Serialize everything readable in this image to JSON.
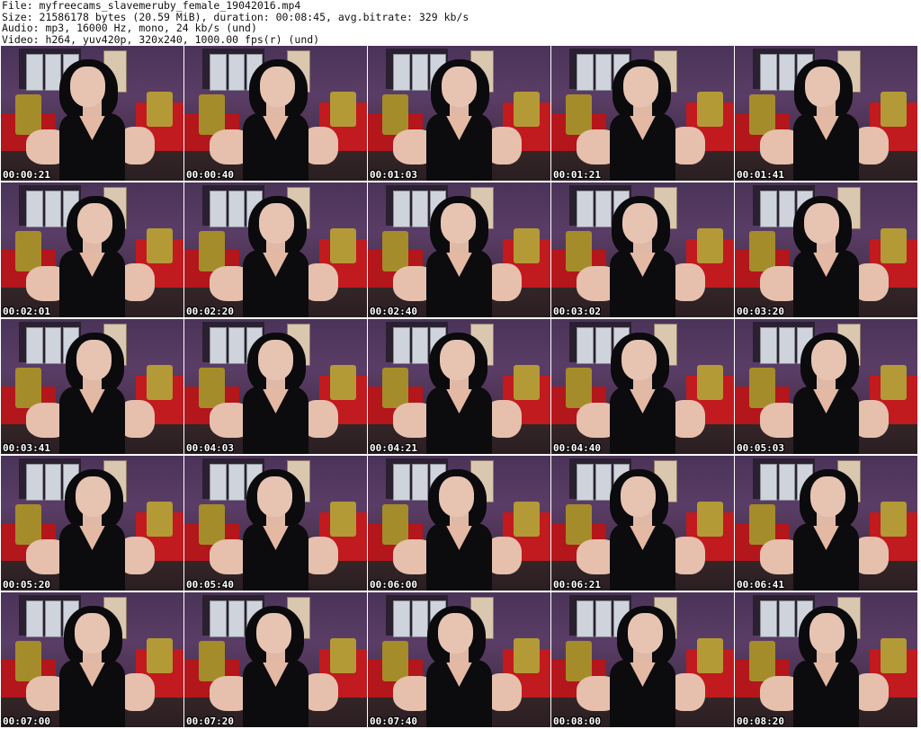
{
  "header": {
    "file_line": "File: myfreecams_slavemeruby_female_19042016.mp4",
    "size_line": "Size: 21586178 bytes (20.59 MiB), duration: 00:08:45, avg.bitrate: 329 kb/s",
    "audio_line": "Audio: mp3, 16000 Hz, mono, 24 kb/s (und)",
    "video_line": "Video: h264, yuv420p, 320x240, 1000.00 fps(r) (und)"
  },
  "thumbnails": [
    {
      "timestamp": "00:00:21"
    },
    {
      "timestamp": "00:00:40"
    },
    {
      "timestamp": "00:01:03"
    },
    {
      "timestamp": "00:01:21"
    },
    {
      "timestamp": "00:01:41"
    },
    {
      "timestamp": "00:02:01"
    },
    {
      "timestamp": "00:02:20"
    },
    {
      "timestamp": "00:02:40"
    },
    {
      "timestamp": "00:03:02"
    },
    {
      "timestamp": "00:03:20"
    },
    {
      "timestamp": "00:03:41"
    },
    {
      "timestamp": "00:04:03"
    },
    {
      "timestamp": "00:04:21"
    },
    {
      "timestamp": "00:04:40"
    },
    {
      "timestamp": "00:05:03"
    },
    {
      "timestamp": "00:05:20"
    },
    {
      "timestamp": "00:05:40"
    },
    {
      "timestamp": "00:06:00"
    },
    {
      "timestamp": "00:06:21"
    },
    {
      "timestamp": "00:06:41"
    },
    {
      "timestamp": "00:07:00"
    },
    {
      "timestamp": "00:07:20"
    },
    {
      "timestamp": "00:07:40"
    },
    {
      "timestamp": "00:08:00"
    },
    {
      "timestamp": "00:08:20"
    }
  ],
  "colors": {
    "wall": "#4a3358",
    "couch": "#b3161b",
    "pillow": "#a58c2a",
    "timestamp_text": "#ffffff"
  }
}
